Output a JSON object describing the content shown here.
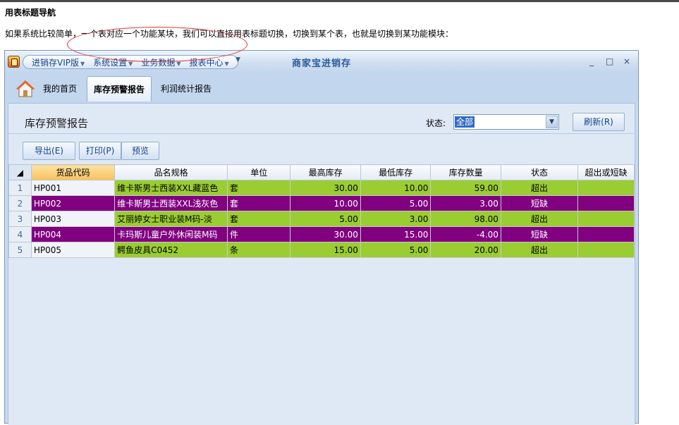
{
  "doc": {
    "heading": "用表标题导航",
    "paragraph": "如果系统比较简单，一个表对应一个功能某块，我们可以直接用表标题切换，切换到某个表，也就是切换到某功能模块："
  },
  "window": {
    "title": "商家宝进销存",
    "menus": [
      "进销存VIP版",
      "系统设置",
      "业务数据",
      "报表中心"
    ],
    "minimize": "_",
    "maximize": "□",
    "close": "×"
  },
  "tabs": [
    {
      "label": "我的首页",
      "active": false
    },
    {
      "label": "库存预警报告",
      "active": true
    },
    {
      "label": "利润统计报告",
      "active": false
    }
  ],
  "report": {
    "title": "库存预警报告",
    "status_label": "状态:",
    "status_value": "全部",
    "refresh_label": "刷新(R)",
    "export_label": "导出(E)",
    "print_label": "打印(P)",
    "preview_label": "预览"
  },
  "table": {
    "columns": [
      "货品代码",
      "品名规格",
      "单位",
      "最高库存",
      "最低库存",
      "库存数量",
      "状态",
      "超出或短缺"
    ],
    "rows": [
      {
        "no": "1",
        "code": "HP001",
        "name": "维卡斯男士西装XXL藏蓝色",
        "unit": "套",
        "max": "30.00",
        "min": "10.00",
        "qty": "59.00",
        "status": "超出",
        "color": "green"
      },
      {
        "no": "2",
        "code": "HP002",
        "name": "维卡斯男士西装XXL浅灰色",
        "unit": "套",
        "max": "10.00",
        "min": "5.00",
        "qty": "3.00",
        "status": "短缺",
        "color": "purple"
      },
      {
        "no": "3",
        "code": "HP003",
        "name": "艾丽婷女士职业装M码-淡",
        "unit": "套",
        "max": "5.00",
        "min": "3.00",
        "qty": "98.00",
        "status": "超出",
        "color": "green"
      },
      {
        "no": "4",
        "code": "HP004",
        "name": "卡玛斯儿童户外休闲装M码",
        "unit": "件",
        "max": "30.00",
        "min": "15.00",
        "qty": "-4.00",
        "status": "短缺",
        "color": "purple"
      },
      {
        "no": "5",
        "code": "HP005",
        "name": "鳄鱼皮具C0452",
        "unit": "条",
        "max": "15.00",
        "min": "5.00",
        "qty": "20.00",
        "status": "超出",
        "color": "green"
      }
    ]
  },
  "colors": {
    "over": "#9acd32",
    "short": "#800080"
  }
}
